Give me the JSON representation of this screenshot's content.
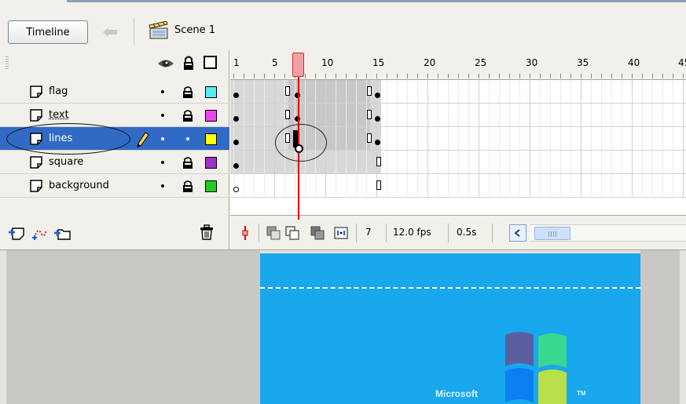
{
  "toolbar": {
    "timeline_label": "Timeline",
    "scene_label": "Scene 1"
  },
  "layers": [
    {
      "name": "flag",
      "swatch": "#55eeee",
      "locked": true
    },
    {
      "name": "text",
      "swatch": "#ee44ee",
      "locked": true
    },
    {
      "name": "lines",
      "swatch": "#ffff00",
      "locked": false,
      "selected": true
    },
    {
      "name": "square",
      "swatch": "#a030c8",
      "locked": true
    },
    {
      "name": "background",
      "swatch": "#22cc22",
      "locked": true
    }
  ],
  "ruler": {
    "labels": [
      "1",
      "5",
      "10",
      "15",
      "20",
      "25",
      "30",
      "35",
      "40",
      "45"
    ]
  },
  "status": {
    "current_frame": "7",
    "frame_rate": "12.0 fps",
    "elapsed": "0.5s"
  },
  "stage": {
    "logo_text": "Microsoft",
    "tm_text": "TM"
  },
  "colors": {
    "selection": "#316ac5",
    "stage_bg": "#19a7ed",
    "panel_bg": "#f1f0eb",
    "playhead": "#e00000"
  }
}
